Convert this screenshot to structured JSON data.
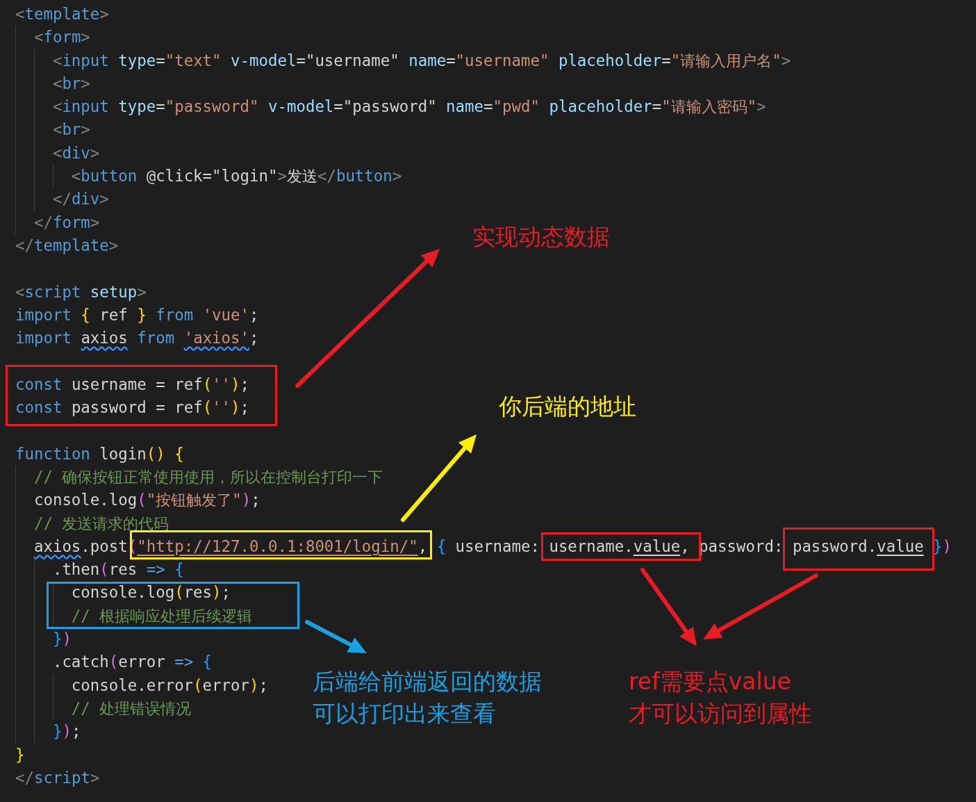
{
  "editor": {
    "lines": [
      {
        "kind": "code",
        "tokens": [
          {
            "kind": "punct",
            "text": "<"
          },
          {
            "kind": "tag",
            "text": "template"
          },
          {
            "kind": "punct",
            "text": ">"
          }
        ],
        "children": [
          {
            "kind": "code",
            "tokens": [
              {
                "kind": "punct",
                "text": "<"
              },
              {
                "kind": "tag",
                "text": "form"
              },
              {
                "kind": "punct",
                "text": ">"
              }
            ],
            "children": [
              {
                "kind": "code",
                "tokens": [
                  {
                    "kind": "punct",
                    "text": "<"
                  },
                  {
                    "kind": "tag",
                    "text": "input"
                  },
                  {
                    "kind": "attr",
                    "text": " type"
                  },
                  {
                    "kind": "plain",
                    "text": "="
                  },
                  {
                    "kind": "string",
                    "text": "\"text\""
                  },
                  {
                    "kind": "attr",
                    "text": " v-model"
                  },
                  {
                    "kind": "plain",
                    "text": "=\"username\""
                  },
                  {
                    "kind": "attr",
                    "text": " name"
                  },
                  {
                    "kind": "plain",
                    "text": "="
                  },
                  {
                    "kind": "string",
                    "text": "\"username\""
                  },
                  {
                    "kind": "attr",
                    "text": " placeholder"
                  },
                  {
                    "kind": "plain",
                    "text": "="
                  },
                  {
                    "kind": "string",
                    "text": "\"请输入用户名\""
                  },
                  {
                    "kind": "punct",
                    "text": ">"
                  }
                ]
              },
              {
                "kind": "code",
                "tokens": [
                  {
                    "kind": "punct",
                    "text": "<"
                  },
                  {
                    "kind": "tag",
                    "text": "br"
                  },
                  {
                    "kind": "punct",
                    "text": ">"
                  }
                ]
              },
              {
                "kind": "code",
                "tokens": [
                  {
                    "kind": "punct",
                    "text": "<"
                  },
                  {
                    "kind": "tag",
                    "text": "input"
                  },
                  {
                    "kind": "attr",
                    "text": " type"
                  },
                  {
                    "kind": "plain",
                    "text": "="
                  },
                  {
                    "kind": "string",
                    "text": "\"password\""
                  },
                  {
                    "kind": "attr",
                    "text": " v-model"
                  },
                  {
                    "kind": "plain",
                    "text": "=\"password\""
                  },
                  {
                    "kind": "attr",
                    "text": " name"
                  },
                  {
                    "kind": "plain",
                    "text": "="
                  },
                  {
                    "kind": "string",
                    "text": "\"pwd\""
                  },
                  {
                    "kind": "attr",
                    "text": " placeholder"
                  },
                  {
                    "kind": "plain",
                    "text": "="
                  },
                  {
                    "kind": "string",
                    "text": "\"请输入密码\""
                  },
                  {
                    "kind": "punct",
                    "text": ">"
                  }
                ]
              },
              {
                "kind": "code",
                "tokens": [
                  {
                    "kind": "punct",
                    "text": "<"
                  },
                  {
                    "kind": "tag",
                    "text": "br"
                  },
                  {
                    "kind": "punct",
                    "text": ">"
                  }
                ]
              },
              {
                "kind": "code",
                "tokens": [
                  {
                    "kind": "punct",
                    "text": "<"
                  },
                  {
                    "kind": "tag",
                    "text": "div"
                  },
                  {
                    "kind": "punct",
                    "text": ">"
                  }
                ],
                "children": [
                  {
                    "kind": "code",
                    "tokens": [
                      {
                        "kind": "punct",
                        "text": "<"
                      },
                      {
                        "kind": "tag",
                        "text": "button"
                      },
                      {
                        "kind": "plain",
                        "text": " @click=\"login\""
                      },
                      {
                        "kind": "punct",
                        "text": ">"
                      },
                      {
                        "kind": "plain",
                        "text": "发送"
                      },
                      {
                        "kind": "punct",
                        "text": "</"
                      },
                      {
                        "kind": "tag",
                        "text": "button"
                      },
                      {
                        "kind": "punct",
                        "text": ">"
                      }
                    ]
                  }
                ]
              },
              {
                "kind": "code",
                "tokens": [
                  {
                    "kind": "punct",
                    "text": "</"
                  },
                  {
                    "kind": "tag",
                    "text": "div"
                  },
                  {
                    "kind": "punct",
                    "text": ">"
                  }
                ]
              }
            ]
          },
          {
            "kind": "code",
            "tokens": [
              {
                "kind": "punct",
                "text": "</"
              },
              {
                "kind": "tag",
                "text": "form"
              },
              {
                "kind": "punct",
                "text": ">"
              }
            ]
          }
        ]
      },
      {
        "kind": "code",
        "tokens": [
          {
            "kind": "punct",
            "text": "</"
          },
          {
            "kind": "tag",
            "text": "template"
          },
          {
            "kind": "punct",
            "text": ">"
          }
        ]
      },
      {
        "kind": "blank"
      },
      {
        "kind": "code",
        "tokens": [
          {
            "kind": "punct",
            "text": "<"
          },
          {
            "kind": "tag",
            "text": "script"
          },
          {
            "kind": "attr",
            "text": " setup"
          },
          {
            "kind": "punct",
            "text": ">"
          }
        ]
      },
      {
        "kind": "code",
        "tokens": [
          {
            "kind": "keyword",
            "text": "import"
          },
          {
            "kind": "brace1",
            "text": " {"
          },
          {
            "kind": "plain",
            "text": " ref"
          },
          {
            "kind": "brace1",
            "text": " }"
          },
          {
            "kind": "keyword",
            "text": " from"
          },
          {
            "kind": "string",
            "text": " 'vue'"
          },
          {
            "kind": "plain",
            "text": ";"
          }
        ]
      },
      {
        "kind": "code",
        "tokens": [
          {
            "kind": "keyword",
            "text": "import "
          },
          {
            "kind": "plain",
            "text": "axios",
            "squiggle": true
          },
          {
            "kind": "keyword",
            "text": " from "
          },
          {
            "kind": "string",
            "text": "'axios'",
            "squiggle": true
          },
          {
            "kind": "plain",
            "text": ";"
          }
        ]
      },
      {
        "kind": "blank"
      },
      {
        "kind": "code",
        "tokens": [
          {
            "kind": "keyword",
            "text": "const"
          },
          {
            "kind": "plain",
            "text": " username = ref"
          },
          {
            "kind": "brace1",
            "text": "("
          },
          {
            "kind": "string",
            "text": "''"
          },
          {
            "kind": "brace1",
            "text": ")"
          },
          {
            "kind": "plain",
            "text": ";"
          }
        ]
      },
      {
        "kind": "code",
        "tokens": [
          {
            "kind": "keyword",
            "text": "const"
          },
          {
            "kind": "plain",
            "text": " password = ref"
          },
          {
            "kind": "brace1",
            "text": "("
          },
          {
            "kind": "string",
            "text": "''"
          },
          {
            "kind": "brace1",
            "text": ")"
          },
          {
            "kind": "plain",
            "text": ";"
          }
        ]
      },
      {
        "kind": "blank"
      },
      {
        "kind": "code",
        "tokens": [
          {
            "kind": "keyword",
            "text": "function"
          },
          {
            "kind": "plain",
            "text": " login"
          },
          {
            "kind": "brace1",
            "text": "()"
          },
          {
            "kind": "brace1",
            "text": " {"
          }
        ],
        "children": [
          {
            "kind": "code",
            "tokens": [
              {
                "kind": "comment",
                "text": "// 确保按钮正常使用使用，所以在控制台打印一下"
              }
            ]
          },
          {
            "kind": "code",
            "tokens": [
              {
                "kind": "plain",
                "text": "console.log"
              },
              {
                "kind": "brace2",
                "text": "("
              },
              {
                "kind": "string",
                "text": "\"按钮触发了\""
              },
              {
                "kind": "brace2",
                "text": ")"
              },
              {
                "kind": "plain",
                "text": ";"
              }
            ]
          },
          {
            "kind": "code",
            "tokens": [
              {
                "kind": "comment",
                "text": "// 发送请求的代码"
              }
            ]
          },
          {
            "kind": "code",
            "tokens": [
              {
                "kind": "plain",
                "text": "axios",
                "squiggle": true
              },
              {
                "kind": "plain",
                "text": ".post"
              },
              {
                "kind": "brace2",
                "text": "("
              },
              {
                "kind": "string",
                "text": "\"http://127.0.0.1:8001/login/\"",
                "underline": true
              },
              {
                "kind": "plain",
                "text": ","
              },
              {
                "kind": "brace3",
                "text": " {"
              },
              {
                "kind": "plain",
                "text": " username: username."
              },
              {
                "kind": "plain",
                "text": "value",
                "underline": true
              },
              {
                "kind": "plain",
                "text": ", password: password."
              },
              {
                "kind": "plain",
                "text": "value",
                "underline": true
              },
              {
                "kind": "brace3",
                "text": " }"
              },
              {
                "kind": "brace2",
                "text": ")"
              }
            ],
            "children": [
              {
                "kind": "code",
                "tokens": [
                  {
                    "kind": "plain",
                    "text": ".then"
                  },
                  {
                    "kind": "brace2",
                    "text": "("
                  },
                  {
                    "kind": "plain",
                    "text": "res"
                  },
                  {
                    "kind": "keyword",
                    "text": " =>"
                  },
                  {
                    "kind": "brace3",
                    "text": " {"
                  }
                ],
                "children": [
                  {
                    "kind": "code",
                    "tokens": [
                      {
                        "kind": "plain",
                        "text": "console.log"
                      },
                      {
                        "kind": "brace1",
                        "text": "("
                      },
                      {
                        "kind": "plain",
                        "text": "res"
                      },
                      {
                        "kind": "brace1",
                        "text": ")"
                      },
                      {
                        "kind": "plain",
                        "text": ";"
                      }
                    ]
                  },
                  {
                    "kind": "code",
                    "tokens": [
                      {
                        "kind": "comment",
                        "text": "// 根据响应处理后续逻辑"
                      }
                    ]
                  }
                ]
              },
              {
                "kind": "code",
                "tokens": [
                  {
                    "kind": "brace3",
                    "text": "}"
                  },
                  {
                    "kind": "brace2",
                    "text": ")"
                  }
                ]
              },
              {
                "kind": "code",
                "tokens": [
                  {
                    "kind": "plain",
                    "text": ".catch"
                  },
                  {
                    "kind": "brace2",
                    "text": "("
                  },
                  {
                    "kind": "plain",
                    "text": "error"
                  },
                  {
                    "kind": "keyword",
                    "text": " =>"
                  },
                  {
                    "kind": "brace3",
                    "text": " {"
                  }
                ],
                "children": [
                  {
                    "kind": "code",
                    "tokens": [
                      {
                        "kind": "plain",
                        "text": "console.error"
                      },
                      {
                        "kind": "brace1",
                        "text": "("
                      },
                      {
                        "kind": "plain",
                        "text": "error"
                      },
                      {
                        "kind": "brace1",
                        "text": ")"
                      },
                      {
                        "kind": "plain",
                        "text": ";"
                      }
                    ]
                  },
                  {
                    "kind": "code",
                    "tokens": [
                      {
                        "kind": "comment",
                        "text": "// 处理错误情况"
                      }
                    ]
                  }
                ]
              },
              {
                "kind": "code",
                "tokens": [
                  {
                    "kind": "brace3",
                    "text": "}"
                  },
                  {
                    "kind": "brace2",
                    "text": ")"
                  },
                  {
                    "kind": "plain",
                    "text": ";"
                  }
                ]
              }
            ]
          }
        ]
      },
      {
        "kind": "code",
        "tokens": [
          {
            "kind": "brace1",
            "text": "}"
          }
        ]
      },
      {
        "kind": "code",
        "tokens": [
          {
            "kind": "punct",
            "text": "</"
          },
          {
            "kind": "tag",
            "text": "script"
          },
          {
            "kind": "punct",
            "text": ">"
          }
        ]
      }
    ]
  },
  "highlight_boxes": [
    {
      "color": "#e81c24"
    },
    {
      "color": "#ffee00"
    },
    {
      "color": "#e81c24"
    },
    {
      "color": "#e81c24"
    },
    {
      "color": "#1a9fe0"
    }
  ],
  "arrows": [
    {
      "color": "#e81c24"
    },
    {
      "color": "#ffee00"
    },
    {
      "color": "#1a9fe0"
    },
    {
      "color": "#e81c24"
    },
    {
      "color": "#e81c24"
    }
  ],
  "notes": [
    {
      "lines": [
        "实现动态数据"
      ],
      "color": "#e81c24"
    },
    {
      "lines": [
        "你后端的地址"
      ],
      "color": "#ffee00"
    },
    {
      "lines": [
        "后端给前端返回的数据",
        "可以打印出来查看"
      ],
      "color": "#1a9fe0"
    },
    {
      "lines": [
        "ref需要点value",
        "才可以访问到属性"
      ],
      "color": "#e81c24"
    }
  ]
}
